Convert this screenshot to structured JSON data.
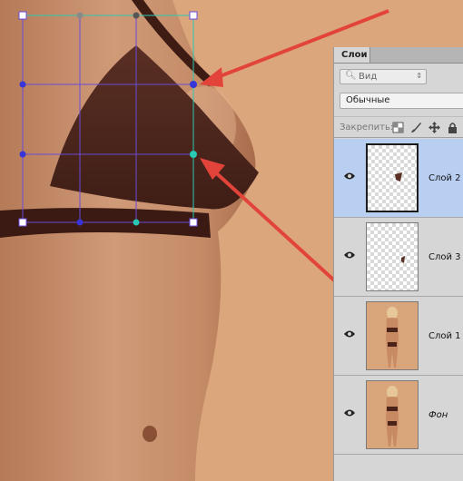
{
  "layers_panel": {
    "tab_label": "Слои",
    "filter_placeholder": "Вид",
    "blend_mode": "Обычные",
    "lock_label": "Закрепить:",
    "layers": [
      {
        "name": "Слой 2",
        "selected": true,
        "thumb": "transparent-fragment"
      },
      {
        "name": "Слой 3",
        "selected": false,
        "thumb": "transparent-fragment"
      },
      {
        "name": "Слой 1",
        "selected": false,
        "thumb": "photo"
      },
      {
        "name": "Фон",
        "selected": false,
        "thumb": "photo"
      }
    ]
  },
  "canvas": {
    "background_color": "#dca67c",
    "transform_grid_color": "#6a4bd8",
    "handle_accent_color": "#28c8b4",
    "annotation_arrow_color": "#e2443a",
    "annotation_arrows": 2,
    "transform_mode": "warp"
  }
}
